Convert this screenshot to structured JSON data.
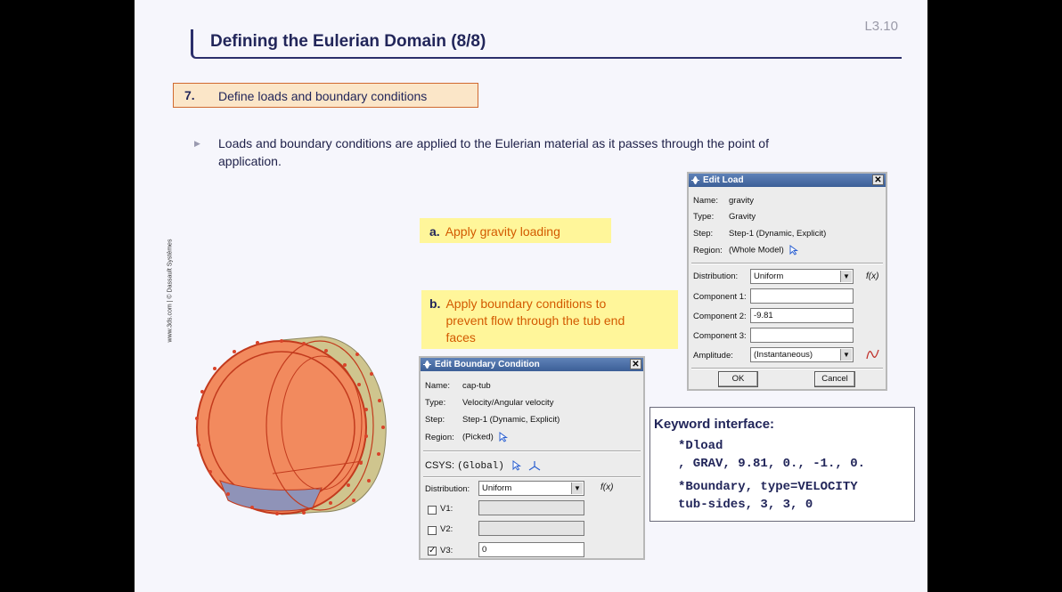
{
  "slide": {
    "number": "L3.10",
    "title": "Defining the Eulerian Domain (8/8)",
    "step_number": "7.",
    "step_text": "Define loads and boundary conditions",
    "bullet_line1": "Loads and boundary conditions are applied to the Eulerian material as it passes through the point of",
    "bullet_line2": "application.",
    "side_credit": "www.3ds.com | © Dassault Systèmes"
  },
  "callouts": {
    "a_label": "a.",
    "a_text": "Apply gravity loading",
    "b_label": "b.",
    "b_text_1": "Apply boundary conditions to",
    "b_text_2": "prevent flow through the tub end",
    "b_text_3": "faces"
  },
  "edit_load": {
    "title": "Edit Load",
    "name_label": "Name:",
    "name_value": "gravity",
    "type_label": "Type:",
    "type_value": "Gravity",
    "step_label": "Step:",
    "step_value": "Step-1 (Dynamic, Explicit)",
    "region_label": "Region:",
    "region_value": "(Whole Model)",
    "distribution_label": "Distribution:",
    "distribution_value": "Uniform",
    "fx": "f(x)",
    "component1_label": "Component 1:",
    "component1_value": "",
    "component2_label": "Component 2:",
    "component2_value": "-9.81",
    "component3_label": "Component 3:",
    "component3_value": "",
    "amplitude_label": "Amplitude:",
    "amplitude_value": "(Instantaneous)",
    "ok_label": "OK",
    "cancel_label": "Cancel"
  },
  "edit_bc": {
    "title": "Edit Boundary Condition",
    "name_label": "Name:",
    "name_value": "cap-tub",
    "type_label": "Type:",
    "type_value": "Velocity/Angular velocity",
    "step_label": "Step:",
    "step_value": "Step-1 (Dynamic, Explicit)",
    "region_label": "Region:",
    "region_value": "(Picked)",
    "csys_label": "CSYS:",
    "csys_value": "(Global)",
    "distribution_label": "Distribution:",
    "distribution_value": "Uniform",
    "fx": "f(x)",
    "v1_label": "V1:",
    "v1_value": "",
    "v1_checked": false,
    "v2_label": "V2:",
    "v2_value": "",
    "v2_checked": false,
    "v3_label": "V3:",
    "v3_value": "0",
    "v3_checked": true,
    "check_mark": "✓"
  },
  "keyword": {
    "title": "Keyword interface:",
    "line1": "*Dload",
    "line2": ", GRAV, 9.81, 0., -1., 0.",
    "line3": "*Boundary, type=VELOCITY",
    "line4": "tub-sides, 3, 3, 0"
  },
  "icons": [
    "arrow-pointer-icon",
    "csys-triad-icon",
    "amplitude-curve-icon",
    "close-icon",
    "dropdown-arrow-icon",
    "bullet-triangle-icon"
  ],
  "colors": {
    "accent": "#22265a",
    "callout_bg": "#fff69a",
    "callout_text": "#d35a00",
    "mesh_face": "#f28a5e",
    "tub_body": "#cfc58e"
  }
}
